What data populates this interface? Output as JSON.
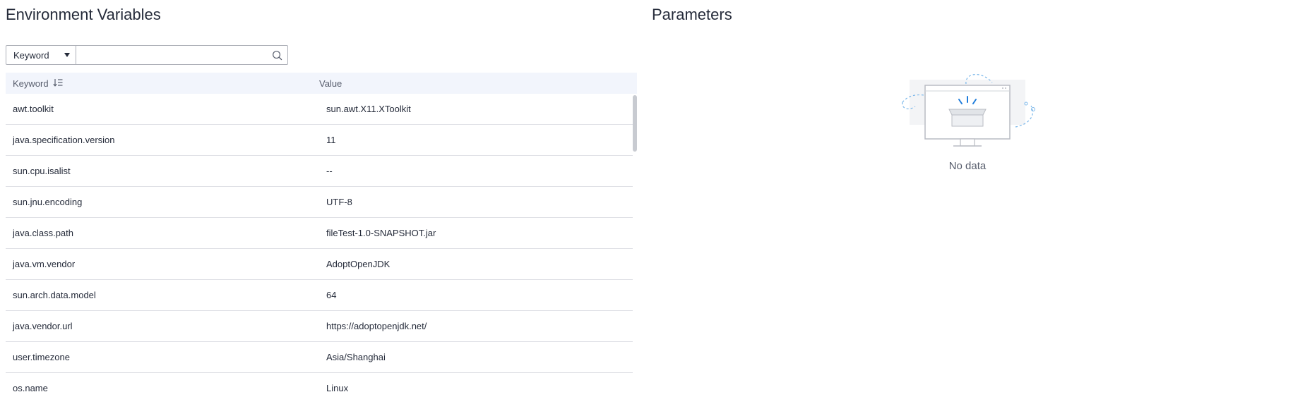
{
  "environment": {
    "title": "Environment Variables",
    "search": {
      "select_value": "Keyword",
      "placeholder": "",
      "value": ""
    },
    "table": {
      "columns": [
        "Keyword",
        "Value"
      ],
      "rows": [
        {
          "key": "awt.toolkit",
          "value": "sun.awt.X11.XToolkit"
        },
        {
          "key": "java.specification.version",
          "value": "11"
        },
        {
          "key": "sun.cpu.isalist",
          "value": "--"
        },
        {
          "key": "sun.jnu.encoding",
          "value": "UTF-8"
        },
        {
          "key": "java.class.path",
          "value": "fileTest-1.0-SNAPSHOT.jar"
        },
        {
          "key": "java.vm.vendor",
          "value": "AdoptOpenJDK"
        },
        {
          "key": "sun.arch.data.model",
          "value": "64"
        },
        {
          "key": "java.vendor.url",
          "value": "https://adoptopenjdk.net/"
        },
        {
          "key": "user.timezone",
          "value": "Asia/Shanghai"
        },
        {
          "key": "os.name",
          "value": "Linux"
        }
      ]
    }
  },
  "parameters": {
    "title": "Parameters",
    "empty_text": "No data"
  },
  "icons": {
    "search": "search-icon",
    "sort": "sort-icon",
    "dropdown": "chevron-down-icon",
    "empty": "no-data-illustration"
  },
  "colors": {
    "accent": "#0077dd",
    "header_bg": "#f2f5fc",
    "border": "#adb0b8"
  }
}
